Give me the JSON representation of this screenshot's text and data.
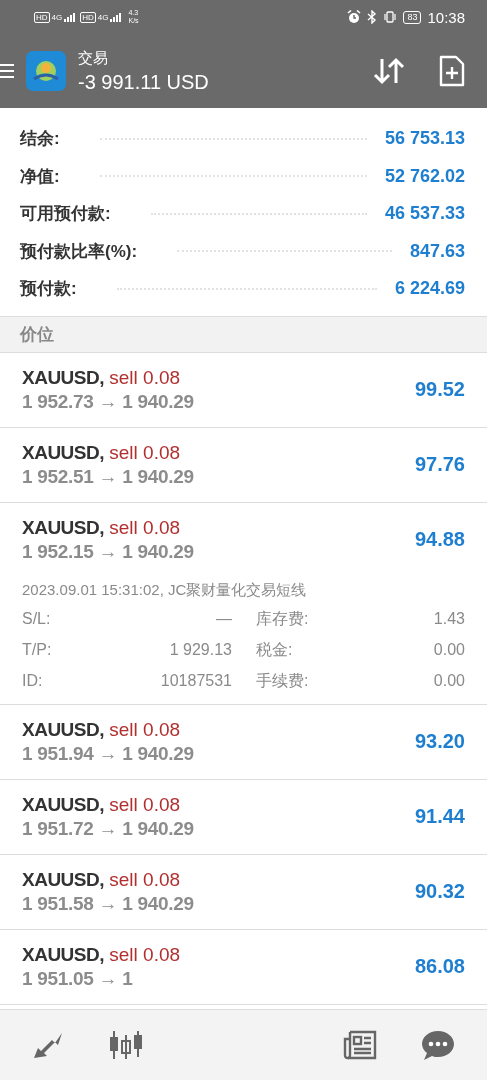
{
  "status_bar": {
    "sims": [
      {
        "badge": "HD",
        "network": "4G"
      },
      {
        "badge": "HD",
        "network": "4G"
      }
    ],
    "speed_value": "4.3",
    "speed_unit": "K/s",
    "battery": "83",
    "time": "10:38"
  },
  "app_bar": {
    "title": "交易",
    "subtitle": "-3 991.11 USD"
  },
  "summary": [
    {
      "label": "结余:",
      "value": "56 753.13"
    },
    {
      "label": "净值:",
      "value": "52 762.02"
    },
    {
      "label": "可用预付款:",
      "value": "46 537.33"
    },
    {
      "label": "预付款比率(%):",
      "value": "847.63"
    },
    {
      "label": "预付款:",
      "value": "6 224.69"
    }
  ],
  "section_title": "价位",
  "positions": [
    {
      "symbol": "XAUUSD,",
      "side": "sell 0.08",
      "prices": "1 952.73 → 1 940.29",
      "profit": "99.52",
      "expanded": false
    },
    {
      "symbol": "XAUUSD,",
      "side": "sell 0.08",
      "prices": "1 952.51 → 1 940.29",
      "profit": "97.76",
      "expanded": false
    },
    {
      "symbol": "XAUUSD,",
      "side": "sell 0.08",
      "prices": "1 952.15 → 1 940.29",
      "profit": "94.88",
      "expanded": true,
      "comment": "2023.09.01 15:31:02, JC聚财量化交易短线",
      "details": [
        [
          "S/L:",
          "—",
          "库存费:",
          "1.43"
        ],
        [
          "T/P:",
          "1 929.13",
          "税金:",
          "0.00"
        ],
        [
          "ID:",
          "10187531",
          "手续费:",
          "0.00"
        ]
      ]
    },
    {
      "symbol": "XAUUSD,",
      "side": "sell 0.08",
      "prices": "1 951.94 → 1 940.29",
      "profit": "93.20",
      "expanded": false
    },
    {
      "symbol": "XAUUSD,",
      "side": "sell 0.08",
      "prices": "1 951.72 → 1 940.29",
      "profit": "91.44",
      "expanded": false
    },
    {
      "symbol": "XAUUSD,",
      "side": "sell 0.08",
      "prices": "1 951.58 → 1 940.29",
      "profit": "90.32",
      "expanded": false
    },
    {
      "symbol": "XAUUSD,",
      "side": "sell 0.08",
      "prices": "1 951.05 → 1",
      "profit": "86.08",
      "expanded": false
    }
  ],
  "bottom_nav": [
    {
      "kind": "quotes",
      "selected": false
    },
    {
      "kind": "chart",
      "selected": false
    },
    {
      "kind": "none"
    },
    {
      "kind": "none"
    },
    {
      "kind": "news",
      "selected": false
    },
    {
      "kind": "chat",
      "selected": false
    }
  ]
}
